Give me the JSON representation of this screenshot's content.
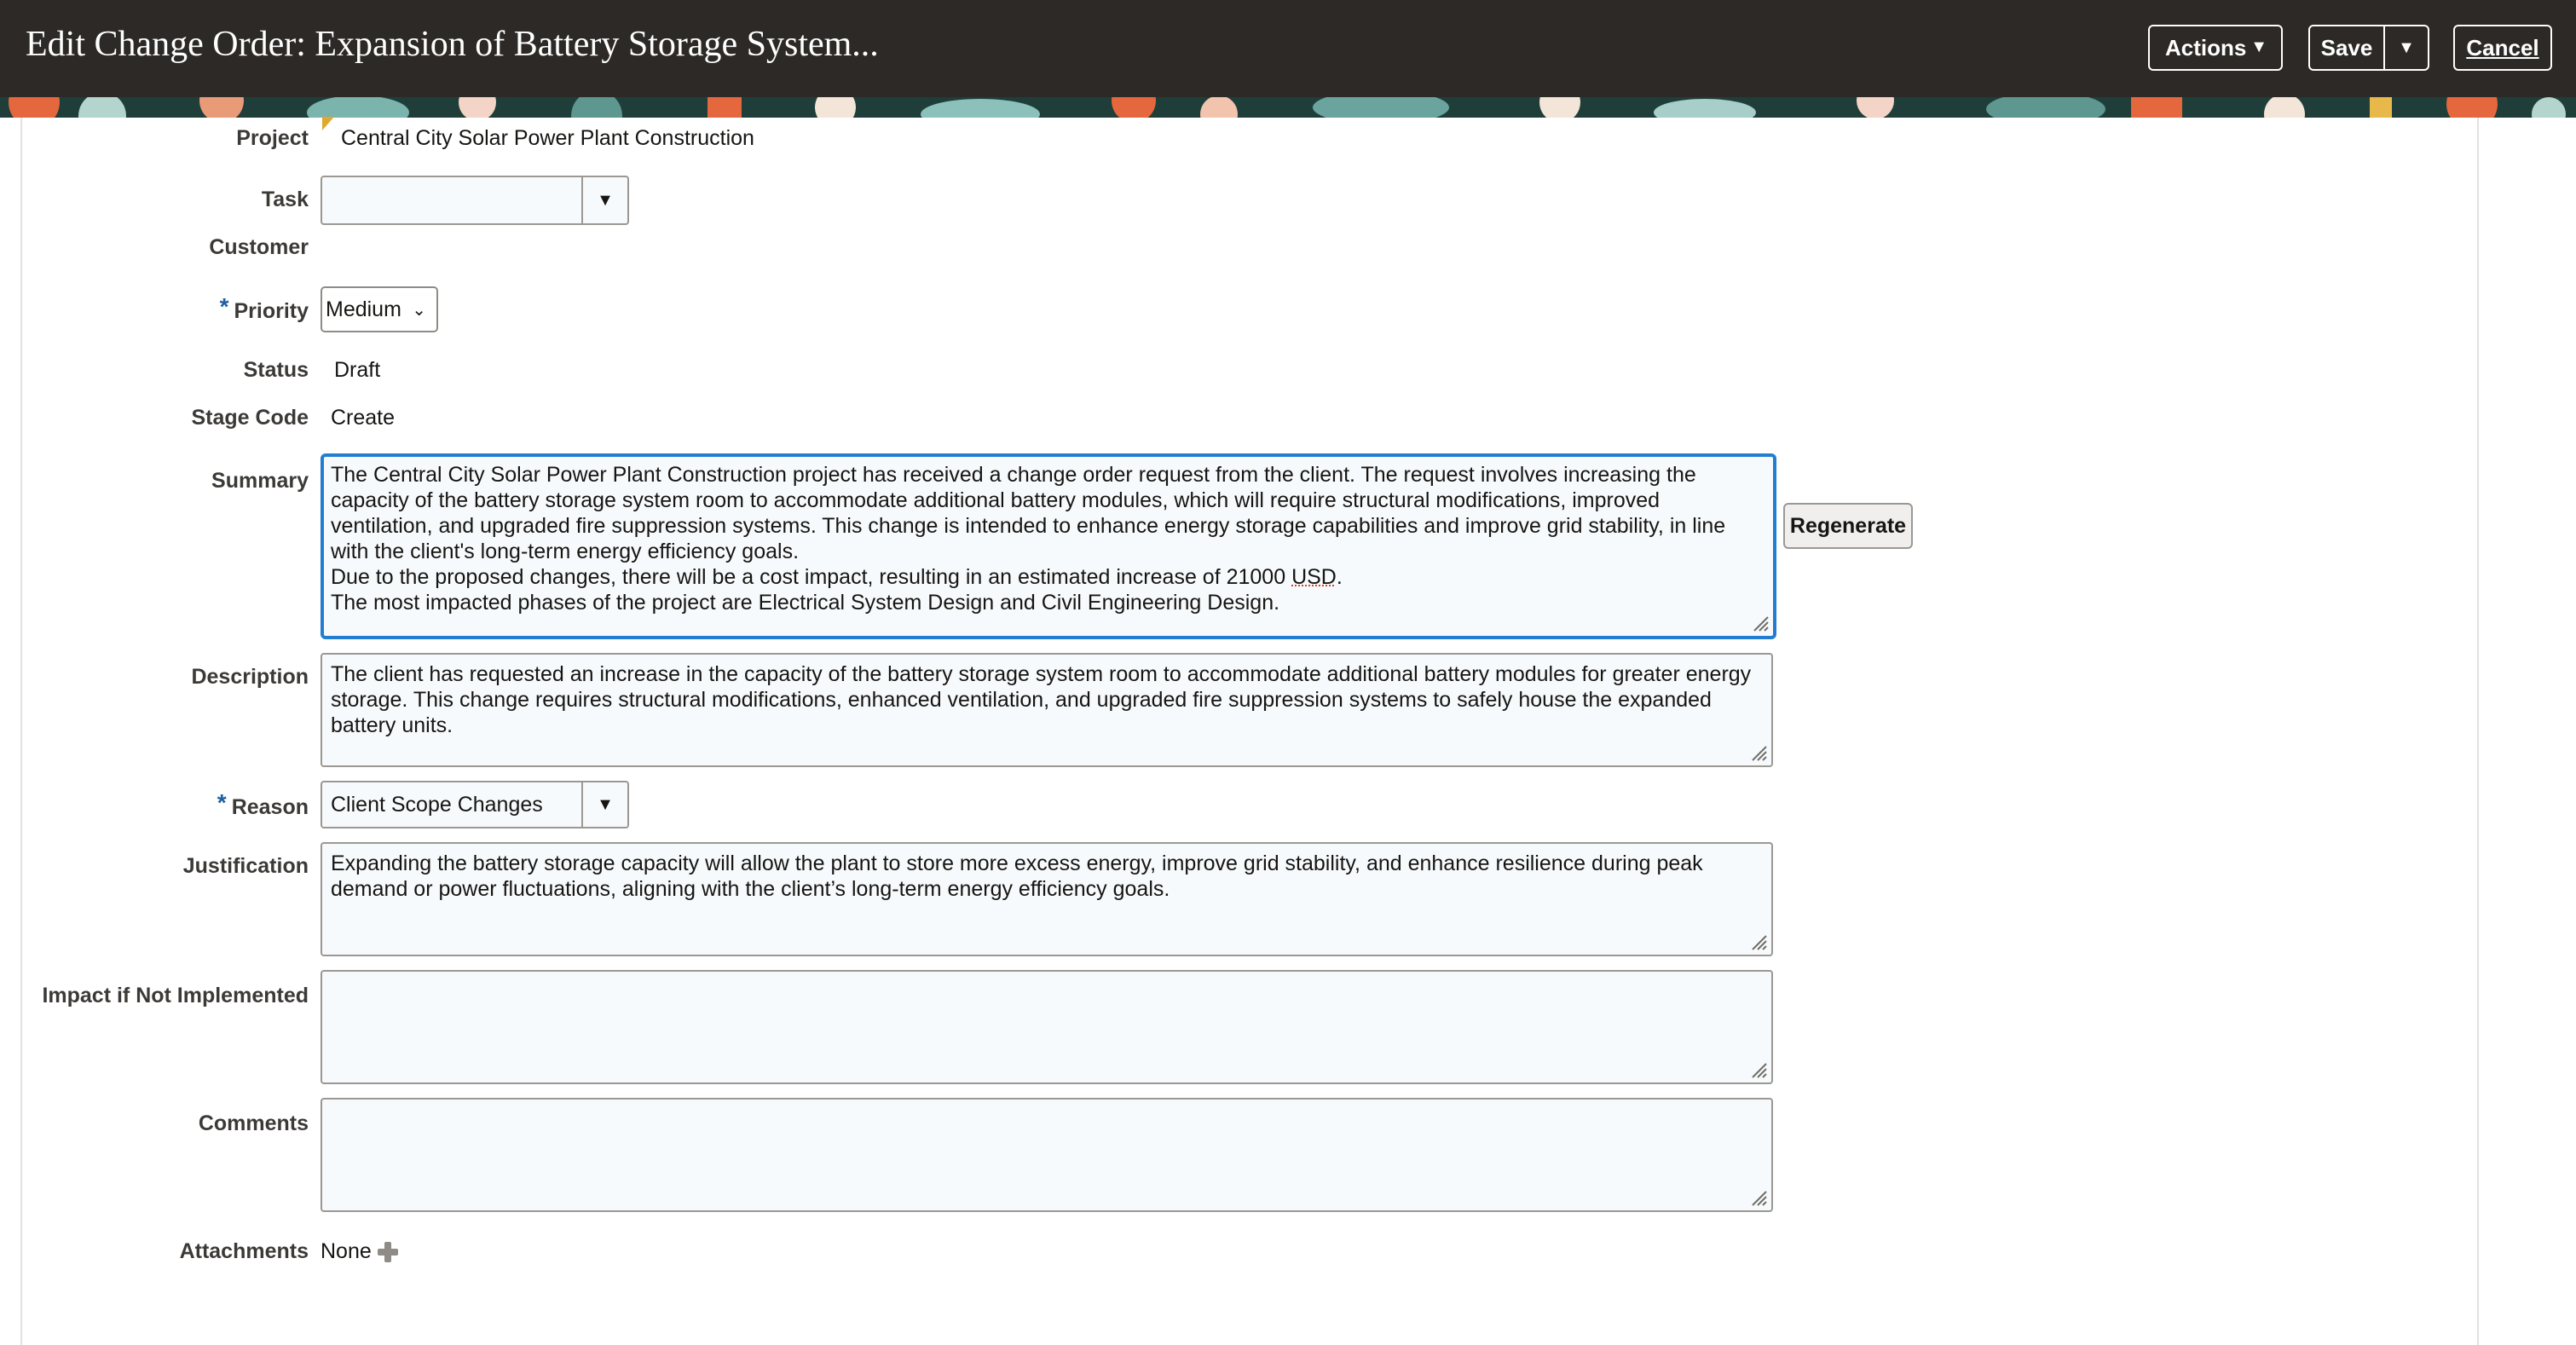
{
  "header": {
    "title": "Edit Change Order: Expansion of Battery Storage System...",
    "actions_label": "Actions",
    "save_label": "Save",
    "cancel_label": "Cancel"
  },
  "form": {
    "project": {
      "label": "Project",
      "value": "Central City Solar Power Plant Construction"
    },
    "task": {
      "label": "Task",
      "value": ""
    },
    "customer": {
      "label": "Customer",
      "value": ""
    },
    "priority": {
      "label": "Priority",
      "required_mark": "*",
      "value": "Medium"
    },
    "status": {
      "label": "Status",
      "value": "Draft"
    },
    "stage_code": {
      "label": "Stage Code",
      "value": "Create"
    },
    "summary": {
      "label": "Summary",
      "paragraph_1": "The Central City Solar Power Plant Construction project has received a change order request from the client. The request involves increasing the capacity of the battery storage system room to accommodate additional battery modules, which will require structural modifications, improved ventilation, and upgraded fire suppression systems. This change is intended to enhance energy storage capabilities and improve grid stability, in line with the client's long-term energy efficiency goals.",
      "paragraph_2_prefix": "Due to the proposed changes, there will be a cost impact, resulting in an estimated increase of 21000 ",
      "paragraph_2_currency": "USD",
      "paragraph_2_suffix": ".",
      "paragraph_3": "The most impacted phases of the project are Electrical System Design and Civil Engineering Design.",
      "regenerate_label": "Regenerate"
    },
    "description": {
      "label": "Description",
      "value": "The client has requested an increase in the capacity of the battery storage system room to accommodate additional battery modules for greater energy storage. This change requires structural modifications, enhanced ventilation, and upgraded fire suppression systems to safely house the expanded battery units."
    },
    "reason": {
      "label": "Reason",
      "required_mark": "*",
      "value": "Client Scope Changes"
    },
    "justification": {
      "label": "Justification",
      "value": "Expanding the battery storage capacity will allow the plant to store more excess energy, improve grid stability, and enhance resilience during peak demand or power fluctuations, aligning with the client’s long-term energy efficiency goals."
    },
    "impact": {
      "label": "Impact if Not Implemented",
      "value": ""
    },
    "comments": {
      "label": "Comments",
      "value": ""
    },
    "attachments": {
      "label": "Attachments",
      "value": "None"
    }
  },
  "colors": {
    "header_bg": "#2c2926",
    "focus_border": "#227dd1",
    "required_star": "#1f5f9f"
  }
}
